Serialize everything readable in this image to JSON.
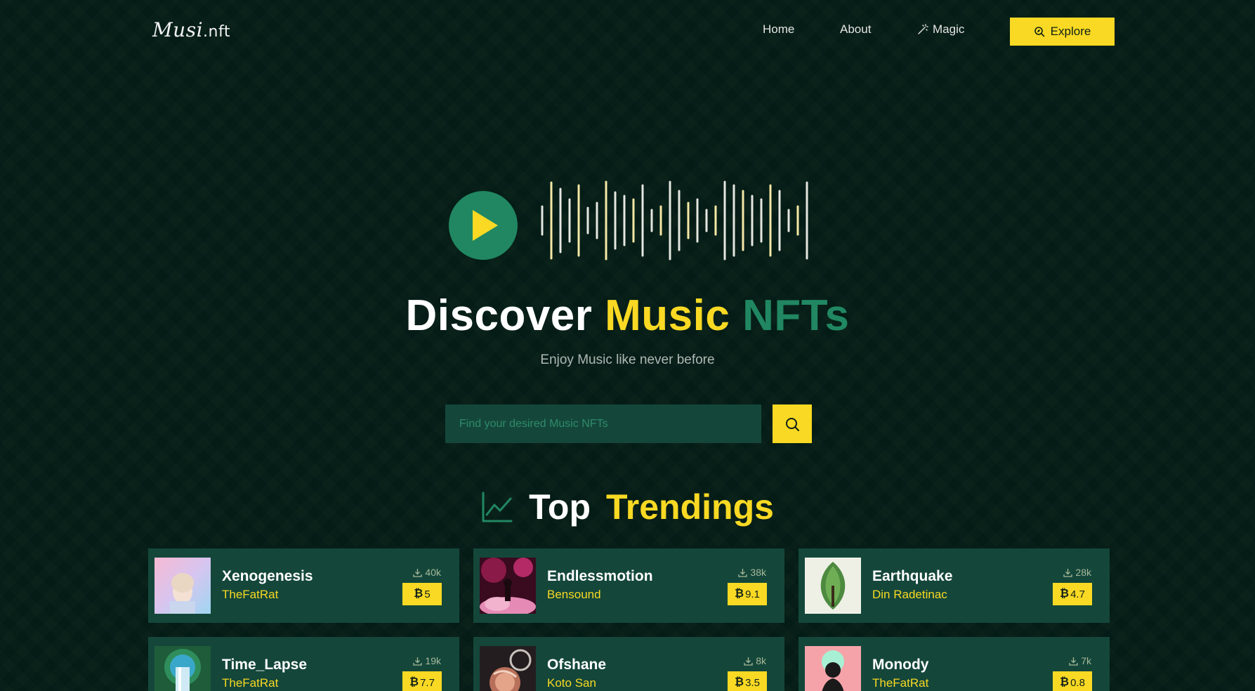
{
  "brand": {
    "logo_script": "Musi",
    "logo_suffix": ".nft"
  },
  "nav": {
    "home": "Home",
    "about": "About",
    "magic": "Magic",
    "explore": "Explore"
  },
  "hero": {
    "title_word1": "Discover",
    "title_word2": "Music",
    "title_word3": "NFTs",
    "subtitle": "Enjoy Music like never before"
  },
  "search": {
    "placeholder": "Find your desired Music NFTs"
  },
  "trending": {
    "title_word1": "Top",
    "title_word2": "Trendings",
    "cards": [
      {
        "name": "Xenogenesis",
        "artist": "TheFatRat",
        "plays": "40k",
        "price": "5"
      },
      {
        "name": "Endlessmotion",
        "artist": "Bensound",
        "plays": "38k",
        "price": "9.1"
      },
      {
        "name": "Earthquake",
        "artist": "Din Radetinac",
        "plays": "28k",
        "price": "4.7"
      },
      {
        "name": "Time_Lapse",
        "artist": "TheFatRat",
        "plays": "19k",
        "price": "7.7"
      },
      {
        "name": "Ofshane",
        "artist": "Koto San",
        "plays": "8k",
        "price": "3.5"
      },
      {
        "name": "Monody",
        "artist": "TheFatRat",
        "plays": "7k",
        "price": "0.8"
      }
    ]
  },
  "colors": {
    "background": "#041c15",
    "accent_yellow": "#f9d923",
    "accent_green": "#208762",
    "card_bg": "#14473a"
  },
  "icons": {
    "play": "play-icon",
    "magic": "magic-wand-icon",
    "explore": "compass-search-icon",
    "search": "search-icon",
    "trending": "trending-chart-icon",
    "plays": "download-icon",
    "currency": "bitcoin-icon"
  }
}
